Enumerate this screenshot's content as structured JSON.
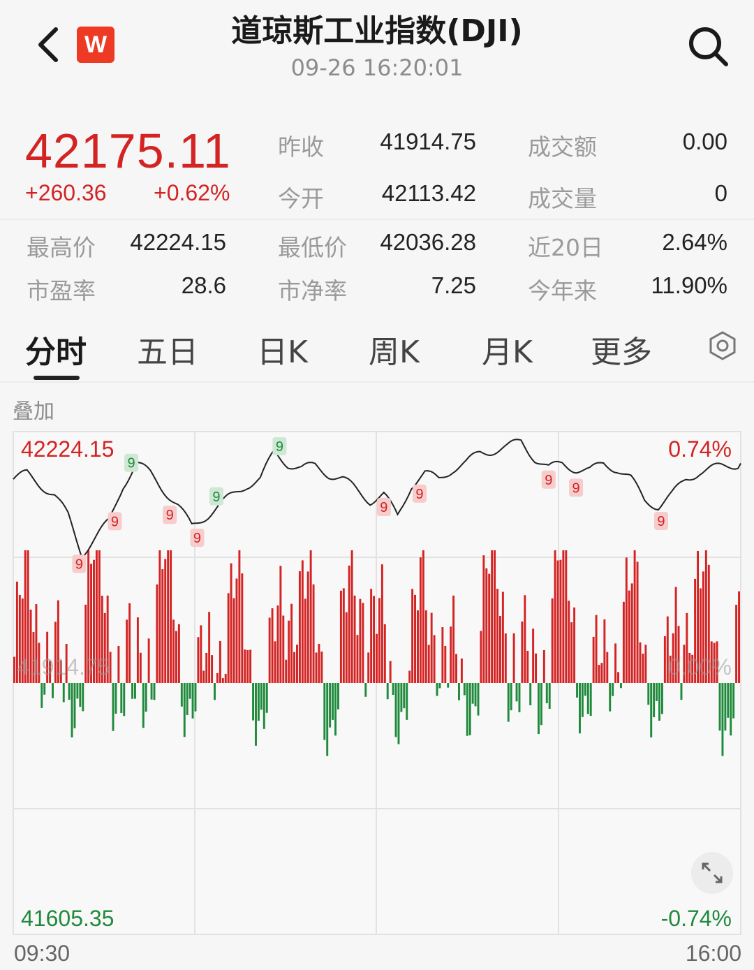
{
  "header": {
    "title": "道琼斯工业指数(DJI)",
    "timestamp": "09-26 16:20:01",
    "logo_text": "W",
    "icons": [
      "back-arrow-icon",
      "search-icon"
    ]
  },
  "quote": {
    "price": "42175.11",
    "change": "+260.36",
    "change_pct": "+0.62%",
    "stats": [
      {
        "label": "昨收",
        "value": "41914.75"
      },
      {
        "label": "成交额",
        "value": "0.00"
      },
      {
        "label": "今开",
        "value": "42113.42"
      },
      {
        "label": "成交量",
        "value": "0"
      },
      {
        "label": "最高价",
        "value": "42224.15"
      },
      {
        "label": "最低价",
        "value": "42036.28"
      },
      {
        "label": "近20日",
        "value": "2.64%"
      },
      {
        "label": "市盈率",
        "value": "28.6"
      },
      {
        "label": "市净率",
        "value": "7.25"
      },
      {
        "label": "今年来",
        "value": "11.90%"
      }
    ]
  },
  "tabs": [
    "分时",
    "五日",
    "日K",
    "周K",
    "月K",
    "更多"
  ],
  "active_tab": "分时",
  "overlay_label": "叠加",
  "colors": {
    "up": "#d32323",
    "down": "#1f8a3c",
    "line": "#222222"
  },
  "chart_data": {
    "type": "line",
    "y_top_label": "42224.15",
    "y_bottom_label": "41605.35",
    "y_mid_label": "41914.75",
    "pct_top": "0.74%",
    "pct_bottom": "-0.74%",
    "pct_mid": "0.00%",
    "x_start": "09:30",
    "x_end": "16:00",
    "ylim": [
      41605.35,
      42224.15
    ],
    "price_path": [
      [
        0,
        42150
      ],
      [
        5,
        42160
      ],
      [
        10,
        42140
      ],
      [
        15,
        42120
      ],
      [
        20,
        42080
      ],
      [
        25,
        42010
      ],
      [
        30,
        42040
      ],
      [
        35,
        42070
      ],
      [
        40,
        42140
      ],
      [
        45,
        42180
      ],
      [
        50,
        42160
      ],
      [
        55,
        42130
      ],
      [
        60,
        42100
      ],
      [
        65,
        42060
      ],
      [
        70,
        42080
      ],
      [
        75,
        42100
      ],
      [
        80,
        42120
      ],
      [
        85,
        42140
      ],
      [
        90,
        42150
      ],
      [
        95,
        42200
      ],
      [
        100,
        42180
      ],
      [
        105,
        42170
      ],
      [
        110,
        42175
      ],
      [
        115,
        42160
      ],
      [
        120,
        42150
      ],
      [
        125,
        42130
      ],
      [
        130,
        42110
      ],
      [
        135,
        42120
      ],
      [
        140,
        42080
      ],
      [
        145,
        42140
      ],
      [
        150,
        42160
      ],
      [
        155,
        42150
      ],
      [
        160,
        42170
      ],
      [
        165,
        42180
      ],
      [
        170,
        42200
      ],
      [
        175,
        42205
      ],
      [
        180,
        42210
      ],
      [
        185,
        42222
      ],
      [
        190,
        42190
      ],
      [
        195,
        42170
      ],
      [
        200,
        42180
      ],
      [
        205,
        42170
      ],
      [
        210,
        42165
      ],
      [
        215,
        42180
      ],
      [
        220,
        42170
      ],
      [
        225,
        42150
      ],
      [
        230,
        42110
      ],
      [
        235,
        42100
      ],
      [
        240,
        42120
      ],
      [
        245,
        42150
      ],
      [
        250,
        42165
      ],
      [
        255,
        42170
      ],
      [
        260,
        42175
      ],
      [
        265,
        42180
      ]
    ],
    "volume_bars_count": 265,
    "nine_markers": [
      {
        "t": 24,
        "color": "red"
      },
      {
        "t": 37,
        "color": "red"
      },
      {
        "t": 43,
        "color": "green"
      },
      {
        "t": 57,
        "color": "red"
      },
      {
        "t": 67,
        "color": "red"
      },
      {
        "t": 74,
        "color": "green"
      },
      {
        "t": 97,
        "color": "green"
      },
      {
        "t": 135,
        "color": "red"
      },
      {
        "t": 148,
        "color": "red"
      },
      {
        "t": 195,
        "color": "red"
      },
      {
        "t": 205,
        "color": "red"
      },
      {
        "t": 236,
        "color": "red"
      }
    ]
  }
}
